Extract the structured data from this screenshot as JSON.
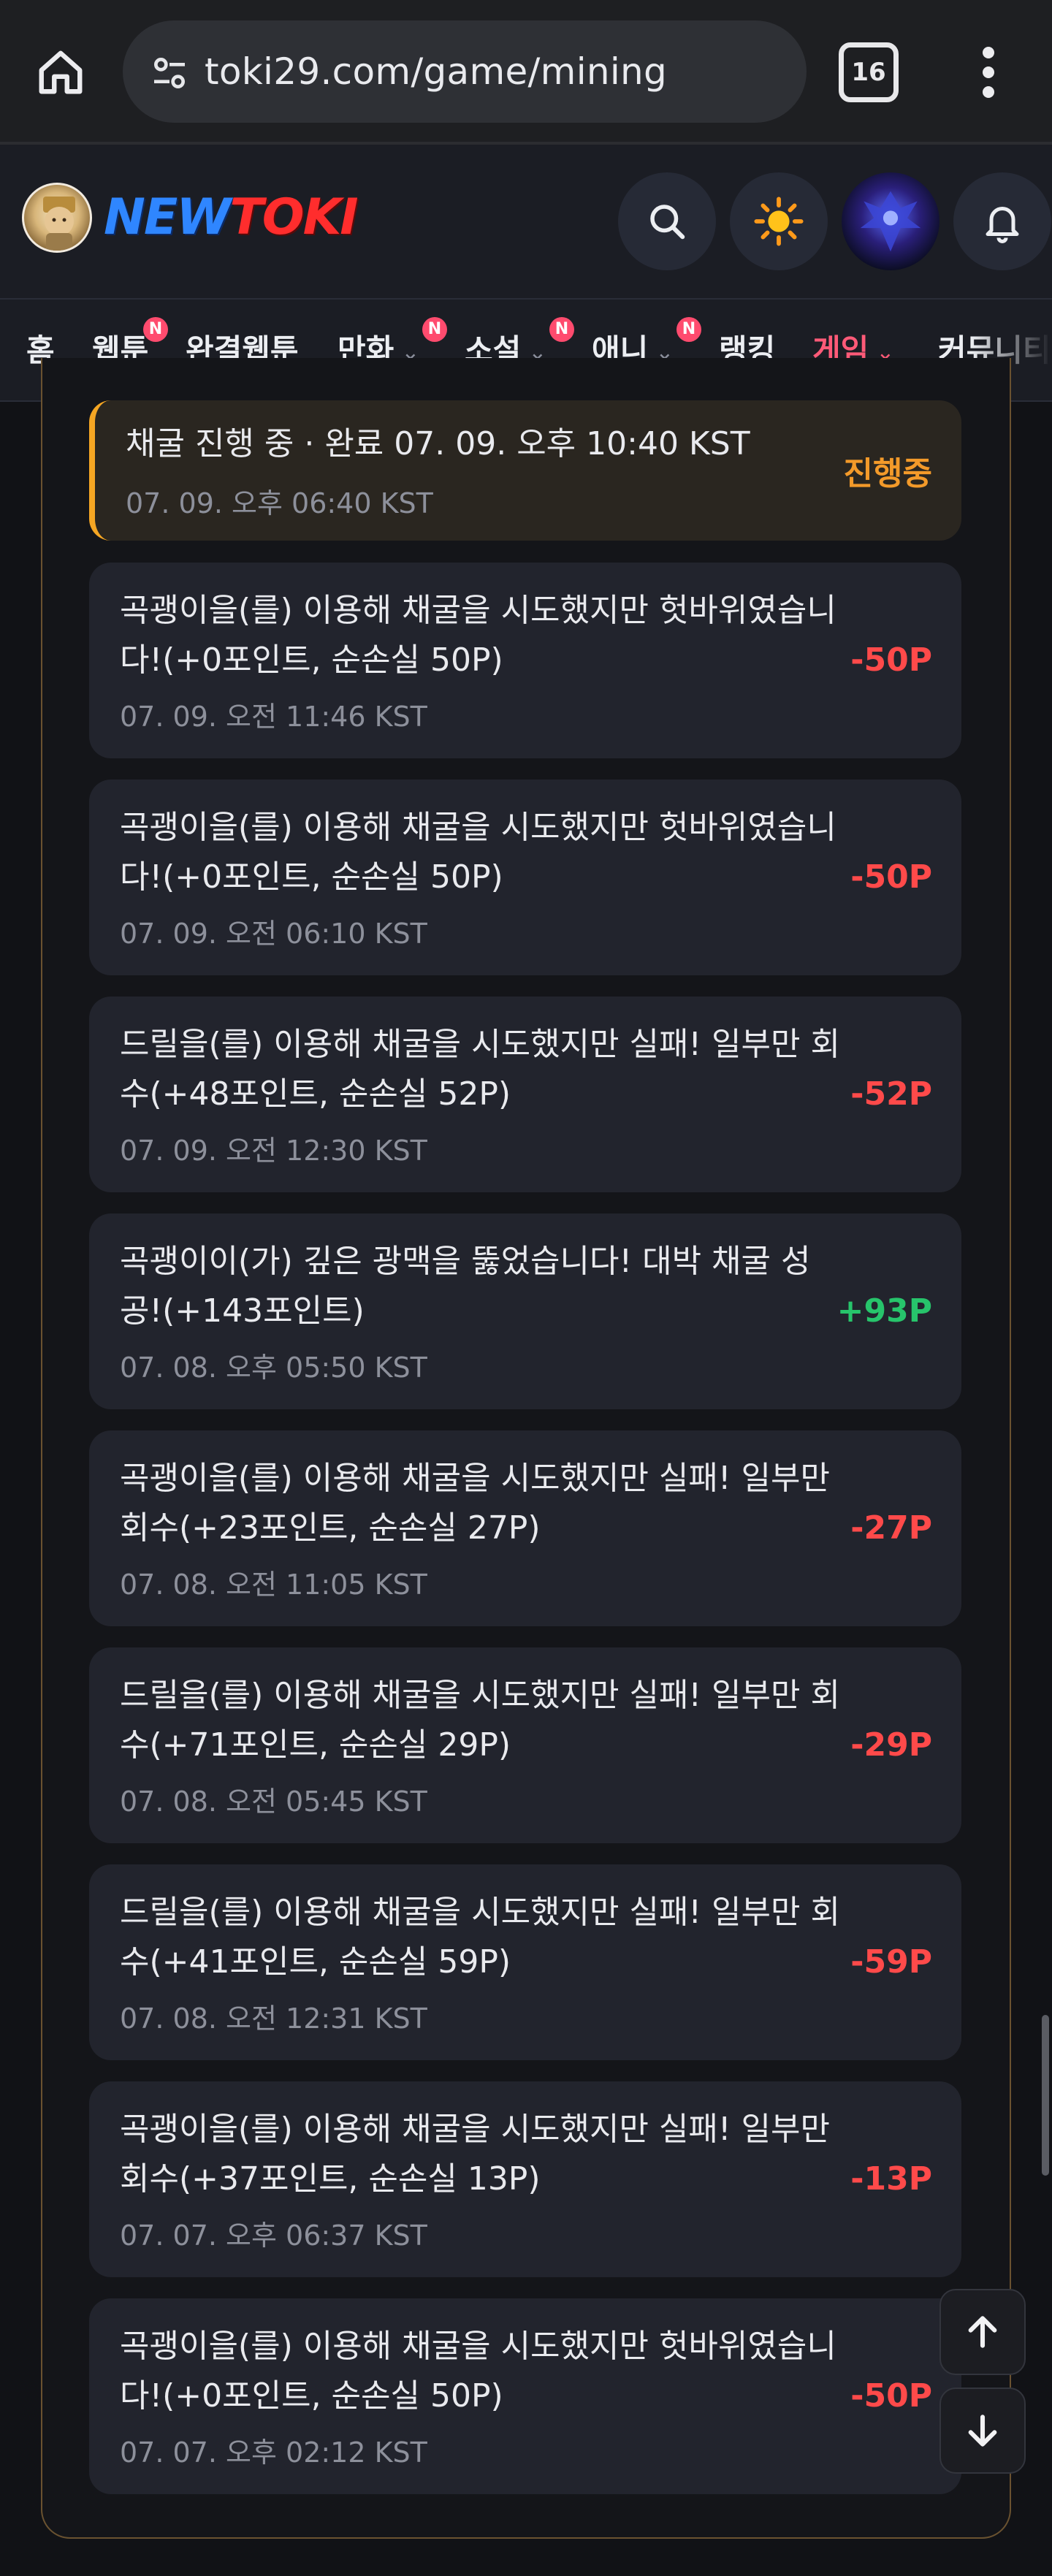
{
  "browser": {
    "url": "toki29.com/game/mining",
    "tab_count": "16"
  },
  "header": {
    "logo_new": "NEW",
    "logo_toki": "TOKI"
  },
  "nav": [
    {
      "label": "홈",
      "badge": "",
      "chevron": false,
      "active": false
    },
    {
      "label": "웹툰",
      "badge": "N",
      "chevron": false,
      "active": false
    },
    {
      "label": "완결웹툰",
      "badge": "",
      "chevron": false,
      "active": false
    },
    {
      "label": "만화",
      "badge": "N",
      "chevron": true,
      "active": false
    },
    {
      "label": "소설",
      "badge": "N",
      "chevron": true,
      "active": false
    },
    {
      "label": "애니",
      "badge": "N",
      "chevron": true,
      "active": false
    },
    {
      "label": "랭킹",
      "badge": "",
      "chevron": false,
      "active": false
    },
    {
      "label": "게임",
      "badge": "",
      "chevron": true,
      "active": true
    },
    {
      "label": "커뮤니티",
      "badge": "",
      "chevron": false,
      "active": false
    }
  ],
  "records": [
    {
      "text": "채굴 진행 중 · 완료 07. 09. 오후 10:40 KST",
      "time": "07. 09. 오후 06:40 KST",
      "value": "진행중",
      "kind": "status"
    },
    {
      "text": "곡괭이을(를) 이용해 채굴을 시도했지만 헛바위였습니다!(+0포인트, 순손실 50P)",
      "time": "07. 09. 오전 11:46 KST",
      "value": "-50P",
      "kind": "neg"
    },
    {
      "text": "곡괭이을(를) 이용해 채굴을 시도했지만 헛바위였습니다!(+0포인트, 순손실 50P)",
      "time": "07. 09. 오전 06:10 KST",
      "value": "-50P",
      "kind": "neg"
    },
    {
      "text": "드릴을(를) 이용해 채굴을 시도했지만 실패! 일부만 회수(+48포인트, 순손실 52P)",
      "time": "07. 09. 오전 12:30 KST",
      "value": "-52P",
      "kind": "neg"
    },
    {
      "text": "곡괭이이(가) 깊은 광맥을 뚫었습니다! 대박 채굴 성공!(+143포인트)",
      "time": "07. 08. 오후 05:50 KST",
      "value": "+93P",
      "kind": "pos"
    },
    {
      "text": "곡괭이을(를) 이용해 채굴을 시도했지만 실패! 일부만 회수(+23포인트, 순손실 27P)",
      "time": "07. 08. 오전 11:05 KST",
      "value": "-27P",
      "kind": "neg"
    },
    {
      "text": "드릴을(를) 이용해 채굴을 시도했지만 실패! 일부만 회수(+71포인트, 순손실 29P)",
      "time": "07. 08. 오전 05:45 KST",
      "value": "-29P",
      "kind": "neg"
    },
    {
      "text": "드릴을(를) 이용해 채굴을 시도했지만 실패! 일부만 회수(+41포인트, 순손실 59P)",
      "time": "07. 08. 오전 12:31 KST",
      "value": "-59P",
      "kind": "neg"
    },
    {
      "text": "곡괭이을(를) 이용해 채굴을 시도했지만 실패! 일부만 회수(+37포인트, 순손실 13P)",
      "time": "07. 07. 오후 06:37 KST",
      "value": "-13P",
      "kind": "neg"
    },
    {
      "text": "곡괭이을(를) 이용해 채굴을 시도했지만 헛바위였습니다!(+0포인트, 순손실 50P)",
      "time": "07. 07. 오후 02:12 KST",
      "value": "-50P",
      "kind": "neg"
    }
  ],
  "icons": {
    "home": "home-icon",
    "tune": "site-settings-icon",
    "search": "search-icon",
    "theme": "sun-icon",
    "bell": "bell-icon",
    "up": "arrow-up-icon",
    "down": "arrow-down-icon"
  }
}
